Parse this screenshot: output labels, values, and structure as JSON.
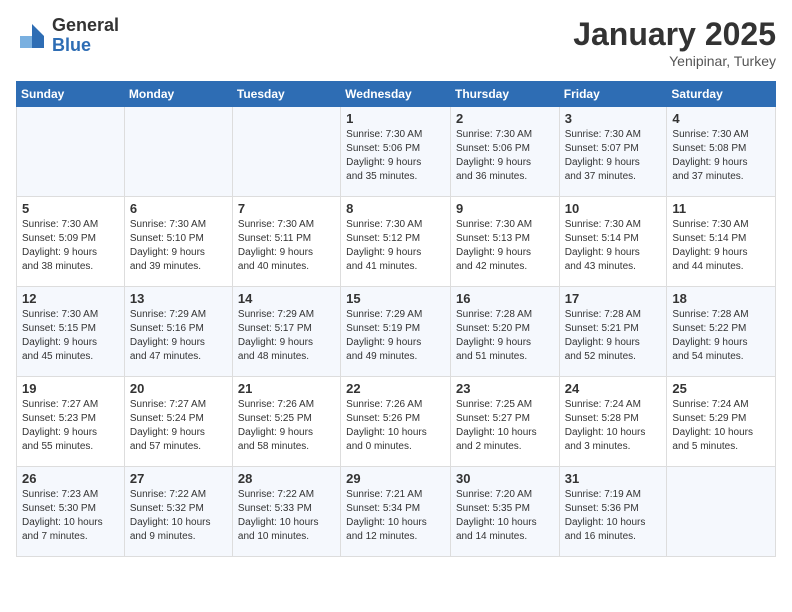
{
  "logo": {
    "general": "General",
    "blue": "Blue"
  },
  "header": {
    "month": "January 2025",
    "location": "Yenipinar, Turkey"
  },
  "days_of_week": [
    "Sunday",
    "Monday",
    "Tuesday",
    "Wednesday",
    "Thursday",
    "Friday",
    "Saturday"
  ],
  "weeks": [
    [
      {
        "day": "",
        "info": ""
      },
      {
        "day": "",
        "info": ""
      },
      {
        "day": "",
        "info": ""
      },
      {
        "day": "1",
        "info": "Sunrise: 7:30 AM\nSunset: 5:06 PM\nDaylight: 9 hours\nand 35 minutes."
      },
      {
        "day": "2",
        "info": "Sunrise: 7:30 AM\nSunset: 5:06 PM\nDaylight: 9 hours\nand 36 minutes."
      },
      {
        "day": "3",
        "info": "Sunrise: 7:30 AM\nSunset: 5:07 PM\nDaylight: 9 hours\nand 37 minutes."
      },
      {
        "day": "4",
        "info": "Sunrise: 7:30 AM\nSunset: 5:08 PM\nDaylight: 9 hours\nand 37 minutes."
      }
    ],
    [
      {
        "day": "5",
        "info": "Sunrise: 7:30 AM\nSunset: 5:09 PM\nDaylight: 9 hours\nand 38 minutes."
      },
      {
        "day": "6",
        "info": "Sunrise: 7:30 AM\nSunset: 5:10 PM\nDaylight: 9 hours\nand 39 minutes."
      },
      {
        "day": "7",
        "info": "Sunrise: 7:30 AM\nSunset: 5:11 PM\nDaylight: 9 hours\nand 40 minutes."
      },
      {
        "day": "8",
        "info": "Sunrise: 7:30 AM\nSunset: 5:12 PM\nDaylight: 9 hours\nand 41 minutes."
      },
      {
        "day": "9",
        "info": "Sunrise: 7:30 AM\nSunset: 5:13 PM\nDaylight: 9 hours\nand 42 minutes."
      },
      {
        "day": "10",
        "info": "Sunrise: 7:30 AM\nSunset: 5:14 PM\nDaylight: 9 hours\nand 43 minutes."
      },
      {
        "day": "11",
        "info": "Sunrise: 7:30 AM\nSunset: 5:14 PM\nDaylight: 9 hours\nand 44 minutes."
      }
    ],
    [
      {
        "day": "12",
        "info": "Sunrise: 7:30 AM\nSunset: 5:15 PM\nDaylight: 9 hours\nand 45 minutes."
      },
      {
        "day": "13",
        "info": "Sunrise: 7:29 AM\nSunset: 5:16 PM\nDaylight: 9 hours\nand 47 minutes."
      },
      {
        "day": "14",
        "info": "Sunrise: 7:29 AM\nSunset: 5:17 PM\nDaylight: 9 hours\nand 48 minutes."
      },
      {
        "day": "15",
        "info": "Sunrise: 7:29 AM\nSunset: 5:19 PM\nDaylight: 9 hours\nand 49 minutes."
      },
      {
        "day": "16",
        "info": "Sunrise: 7:28 AM\nSunset: 5:20 PM\nDaylight: 9 hours\nand 51 minutes."
      },
      {
        "day": "17",
        "info": "Sunrise: 7:28 AM\nSunset: 5:21 PM\nDaylight: 9 hours\nand 52 minutes."
      },
      {
        "day": "18",
        "info": "Sunrise: 7:28 AM\nSunset: 5:22 PM\nDaylight: 9 hours\nand 54 minutes."
      }
    ],
    [
      {
        "day": "19",
        "info": "Sunrise: 7:27 AM\nSunset: 5:23 PM\nDaylight: 9 hours\nand 55 minutes."
      },
      {
        "day": "20",
        "info": "Sunrise: 7:27 AM\nSunset: 5:24 PM\nDaylight: 9 hours\nand 57 minutes."
      },
      {
        "day": "21",
        "info": "Sunrise: 7:26 AM\nSunset: 5:25 PM\nDaylight: 9 hours\nand 58 minutes."
      },
      {
        "day": "22",
        "info": "Sunrise: 7:26 AM\nSunset: 5:26 PM\nDaylight: 10 hours\nand 0 minutes."
      },
      {
        "day": "23",
        "info": "Sunrise: 7:25 AM\nSunset: 5:27 PM\nDaylight: 10 hours\nand 2 minutes."
      },
      {
        "day": "24",
        "info": "Sunrise: 7:24 AM\nSunset: 5:28 PM\nDaylight: 10 hours\nand 3 minutes."
      },
      {
        "day": "25",
        "info": "Sunrise: 7:24 AM\nSunset: 5:29 PM\nDaylight: 10 hours\nand 5 minutes."
      }
    ],
    [
      {
        "day": "26",
        "info": "Sunrise: 7:23 AM\nSunset: 5:30 PM\nDaylight: 10 hours\nand 7 minutes."
      },
      {
        "day": "27",
        "info": "Sunrise: 7:22 AM\nSunset: 5:32 PM\nDaylight: 10 hours\nand 9 minutes."
      },
      {
        "day": "28",
        "info": "Sunrise: 7:22 AM\nSunset: 5:33 PM\nDaylight: 10 hours\nand 10 minutes."
      },
      {
        "day": "29",
        "info": "Sunrise: 7:21 AM\nSunset: 5:34 PM\nDaylight: 10 hours\nand 12 minutes."
      },
      {
        "day": "30",
        "info": "Sunrise: 7:20 AM\nSunset: 5:35 PM\nDaylight: 10 hours\nand 14 minutes."
      },
      {
        "day": "31",
        "info": "Sunrise: 7:19 AM\nSunset: 5:36 PM\nDaylight: 10 hours\nand 16 minutes."
      },
      {
        "day": "",
        "info": ""
      }
    ]
  ]
}
